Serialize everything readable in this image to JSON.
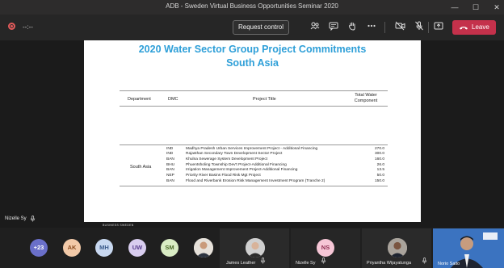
{
  "window": {
    "title": "ADB - Sweden Virtual Business Opportunities Seminar 2020",
    "minimize": "—",
    "maximize": "☐",
    "close": "✕"
  },
  "toolbar": {
    "timer": "--:--",
    "request_control": "Request control",
    "leave": "Leave",
    "icons": [
      "participants-icon",
      "chat-icon",
      "raise-hand-icon",
      "more-icon",
      "camera-off-icon",
      "mic-off-icon",
      "share-icon",
      "phone-icon"
    ]
  },
  "slide": {
    "title_line1": "2020 Water Sector Group Project Commitments",
    "title_line2": "South Asia",
    "headers": {
      "department": "Department",
      "dmc": "DMC",
      "project_title": "Project Title",
      "total_water_line1": "Total Water",
      "total_water_line2": "Component"
    },
    "region": "South Asia",
    "rows": [
      {
        "dmc": "IND",
        "title": "Madhya Pradesh Urban Services Improvement Project - Additional Financing",
        "amount": "270.0"
      },
      {
        "dmc": "IND",
        "title": "Rajasthan Secondary Town Development Sector Project",
        "amount": "300.0"
      },
      {
        "dmc": "BAN",
        "title": "Khulna Sewerage System Development Project",
        "amount": "160.0"
      },
      {
        "dmc": "BHU",
        "title": "Phuentsholing Township Dev't Project-Additional Financing",
        "amount": "26.0"
      },
      {
        "dmc": "BAN",
        "title": "Irrigation Management Improvement Project-Additional Financing",
        "amount": "13.5"
      },
      {
        "dmc": "NEP",
        "title": "Priority River Basins Flood Risk Mgt Project",
        "amount": "50.0"
      },
      {
        "dmc": "BAN",
        "title": "Flood and Riverbank Erosion Risk Management Investment Program (Tranche 2)",
        "amount": "150.0"
      }
    ]
  },
  "speaker": {
    "name": "Nizelle Sy",
    "caption_tag": "BUSINESS SWEDEN"
  },
  "gallery": {
    "overflow_count": "+23",
    "avatars": [
      {
        "initials": "AK",
        "bg": "#f2c9a8",
        "fg": "#8a4b1f"
      },
      {
        "initials": "MH",
        "bg": "#c8d8f0",
        "fg": "#3a5a8a"
      },
      {
        "initials": "UW",
        "bg": "#d8cdef",
        "fg": "#5a3f8f"
      },
      {
        "initials": "SM",
        "bg": "#d9ecc4",
        "fg": "#4d6b2b"
      }
    ],
    "tiles": [
      {
        "name": "James Leather"
      },
      {
        "name": "Nizelle Sy",
        "initials": "NS",
        "bg": "#f6c6d6",
        "fg": "#8f2f52"
      },
      {
        "name": "Priyantha Wijayatunga"
      },
      {
        "name": "Norio Saito"
      }
    ]
  },
  "colors": {
    "accent_title": "#2e9fd8",
    "leave_button": "#c4314b",
    "overflow_badge": "#6a6fc9"
  }
}
